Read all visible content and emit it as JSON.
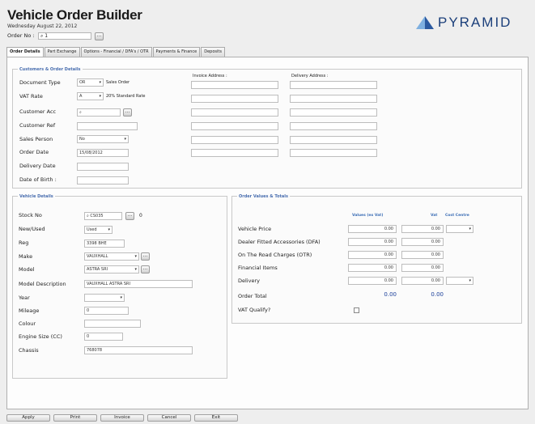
{
  "app": {
    "title": "Vehicle Order Builder",
    "date": "Wednesday August 22, 2012",
    "order_no_label": "Order No :",
    "order_no_value": "1"
  },
  "logo": {
    "text": "PYRAMID",
    "color": "#1b3f7a"
  },
  "tabs": [
    {
      "label": "Order Details",
      "active": true
    },
    {
      "label": "Part Exchange"
    },
    {
      "label": "Options - Financial / DFA's / OTR"
    },
    {
      "label": "Payments & Finance"
    },
    {
      "label": "Deposits"
    }
  ],
  "customer": {
    "title": "Customers & Order Details",
    "document_type_label": "Document Type",
    "document_type_value": "OR",
    "document_type_desc": "Sales Order",
    "vat_rate_label": "VAT Rate",
    "vat_rate_value": "A",
    "vat_rate_desc": "20% Standard Rate",
    "customer_acc_label": "Customer Acc",
    "customer_ref_label": "Customer Ref",
    "sales_person_label": "Sales Person",
    "sales_person_value": "No",
    "order_date_label": "Order Date",
    "order_date_value": "15/08/2012",
    "delivery_date_label": "Delivery Date",
    "dob_label": "Date of Birth :",
    "invoice_address_label": "Invoice Address :",
    "delivery_address_label": "Delivery Address :"
  },
  "vehicle": {
    "title": "Vehicle Details",
    "stock_no_label": "Stock No",
    "stock_no_value": "CS035",
    "stock_count": "0",
    "new_used_label": "New/Used",
    "new_used_value": "Used",
    "reg_label": "Reg",
    "reg_value": "3398 BHE",
    "make_label": "Make",
    "make_value": "VAUXHALL",
    "model_label": "Model",
    "model_value": "ASTRA SRI",
    "model_desc_label": "Model Description",
    "model_desc_value": "VAUXHALL ASTRA SRI",
    "year_label": "Year",
    "mileage_label": "Mileage",
    "mileage_value": "0",
    "colour_label": "Colour",
    "engine_label": "Engine Size (CC)",
    "engine_value": "0",
    "chassis_label": "Chassis",
    "chassis_value": "768078"
  },
  "order_values": {
    "title": "Order Values & Totals",
    "col_ex_vat": "Values (ex Vat)",
    "col_vat": "Vat",
    "col_cost_centre": "Cost Centre",
    "rows": [
      {
        "label": "Vehicle Price",
        "ex_vat": "0.00",
        "vat": "0.00"
      },
      {
        "label": "Dealer Fitted Accessories (DFA)",
        "ex_vat": "0.00",
        "vat": "0.00"
      },
      {
        "label": "On The Road Charges (OTR)",
        "ex_vat": "0.00",
        "vat": "0.00"
      },
      {
        "label": "Financial Items",
        "ex_vat": "0.00",
        "vat": "0.00"
      },
      {
        "label": "Delivery",
        "ex_vat": "0.00",
        "vat": "0.00"
      }
    ],
    "order_total_label": "Order Total",
    "order_total_ex_vat": "0.00",
    "order_total_vat": "0.00",
    "vat_qualify_label": "VAT Qualify?"
  },
  "footer": {
    "apply": "Apply",
    "print": "Print",
    "invoice": "Invoice",
    "cancel": "Cancel",
    "exit": "Exit"
  }
}
